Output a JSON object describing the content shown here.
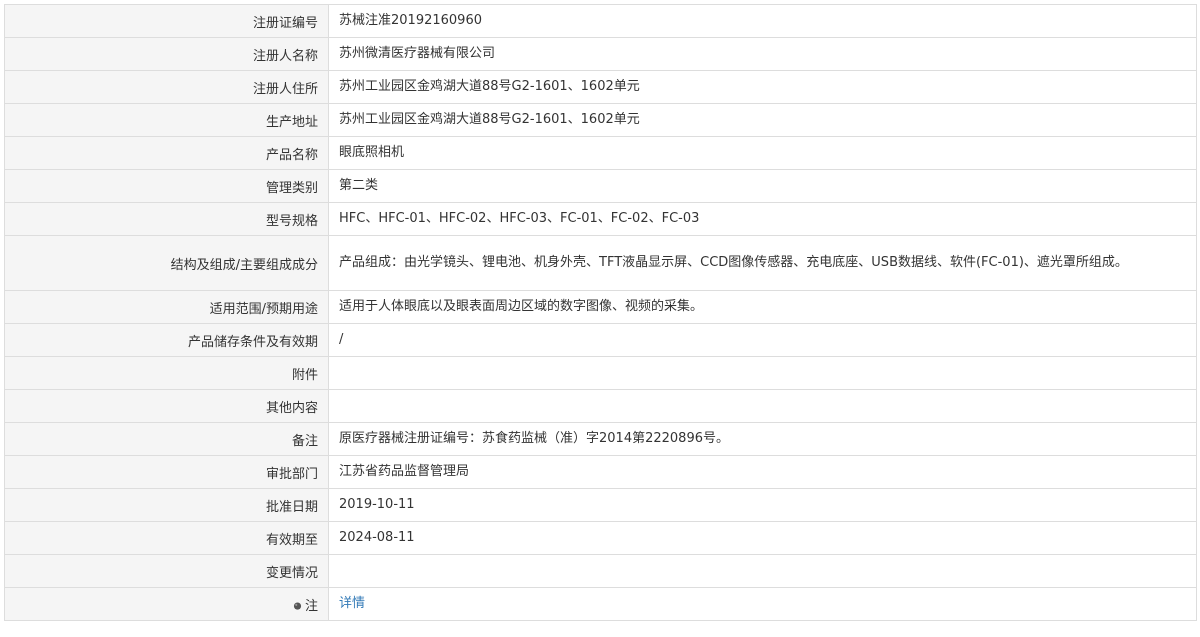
{
  "rows": [
    {
      "label": "注册证编号",
      "value": "苏械注准20192160960"
    },
    {
      "label": "注册人名称",
      "value": "苏州微清医疗器械有限公司"
    },
    {
      "label": "注册人住所",
      "value": "苏州工业园区金鸡湖大道88号G2-1601、1602单元"
    },
    {
      "label": "生产地址",
      "value": "苏州工业园区金鸡湖大道88号G2-1601、1602单元"
    },
    {
      "label": "产品名称",
      "value": "眼底照相机"
    },
    {
      "label": "管理类别",
      "value": "第二类"
    },
    {
      "label": "型号规格",
      "value": "HFC、HFC-01、HFC-02、HFC-03、FC-01、FC-02、FC-03"
    },
    {
      "label": "结构及组成/主要组成成分",
      "value": "产品组成：由光学镜头、锂电池、机身外壳、TFT液晶显示屏、CCD图像传感器、充电底座、USB数据线、软件(FC-01)、遮光罩所组成。"
    },
    {
      "label": "适用范围/预期用途",
      "value": "适用于人体眼底以及眼表面周边区域的数字图像、视频的采集。"
    },
    {
      "label": "产品储存条件及有效期",
      "value": "/"
    },
    {
      "label": "附件",
      "value": ""
    },
    {
      "label": "其他内容",
      "value": ""
    },
    {
      "label": "备注",
      "value": "原医疗器械注册证编号：苏食药监械（准）字2014第2220896号。"
    },
    {
      "label": "审批部门",
      "value": "江苏省药品监督管理局"
    },
    {
      "label": "批准日期",
      "value": "2019-10-11"
    },
    {
      "label": "有效期至",
      "value": "2024-08-11"
    },
    {
      "label": "变更情况",
      "value": ""
    }
  ],
  "note": {
    "icon": "pin-icon",
    "label": "注",
    "link_text": "详情",
    "icon_color": "#555555",
    "link_color": "#337ab7"
  }
}
